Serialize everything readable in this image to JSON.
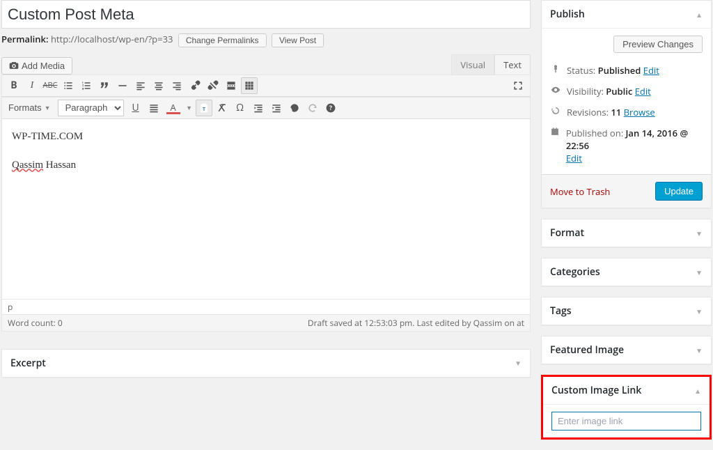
{
  "title": "Custom Post Meta",
  "permalink": {
    "label": "Permalink:",
    "url": "http://localhost/wp-en/?p=33",
    "change": "Change Permalinks",
    "view": "View Post"
  },
  "media": {
    "add": "Add Media"
  },
  "tabs": {
    "visual": "Visual",
    "text": "Text"
  },
  "toolbar": {
    "formats": "Formats",
    "paragraph": "Paragraph"
  },
  "editor": {
    "line1": "WP-TIME.COM",
    "line2a": "Qassim",
    "line2b": " Hassan",
    "path": "p"
  },
  "status": {
    "wordcount_lbl": "Word count: ",
    "wordcount_val": "0",
    "draft_saved": "Draft saved at 12:53:03 pm. Last edited by Qassim on at"
  },
  "excerpt": {
    "title": "Excerpt"
  },
  "publish": {
    "title": "Publish",
    "preview": "Preview Changes",
    "status_lbl": "Status: ",
    "status_val": "Published",
    "status_edit": "Edit",
    "vis_lbl": "Visibility: ",
    "vis_val": "Public",
    "vis_edit": "Edit",
    "rev_lbl": "Revisions: ",
    "rev_val": "11",
    "rev_browse": "Browse",
    "pub_lbl": "Published on: ",
    "pub_val": "Jan 14, 2016 @ 22:56",
    "pub_edit": "Edit",
    "trash": "Move to Trash",
    "update": "Update"
  },
  "panels": {
    "format": "Format",
    "categories": "Categories",
    "tags": "Tags",
    "featured": "Featured Image"
  },
  "custom_image": {
    "title": "Custom Image Link",
    "placeholder": "Enter image link"
  }
}
